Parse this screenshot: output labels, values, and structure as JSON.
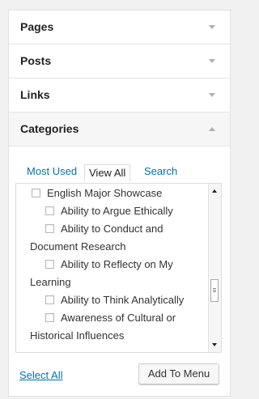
{
  "sections": [
    {
      "label": "Pages",
      "state": "collapsed"
    },
    {
      "label": "Posts",
      "state": "collapsed"
    },
    {
      "label": "Links",
      "state": "collapsed"
    },
    {
      "label": "Categories",
      "state": "expanded"
    }
  ],
  "tabs": [
    {
      "label": "Most Used",
      "active": false
    },
    {
      "label": "View All",
      "active": true
    },
    {
      "label": "Search",
      "active": false
    }
  ],
  "categories": [
    {
      "line1": "English Major Showcase",
      "level": 0,
      "checked": false
    },
    {
      "line1": "Ability to Argue Ethically",
      "level": 1,
      "checked": false
    },
    {
      "line1": "Ability to Conduct and",
      "line2": "Document Research",
      "level": 1,
      "checked": false
    },
    {
      "line1": "Ability to Reflecty on My",
      "line2": "Learning",
      "level": 1,
      "checked": false
    },
    {
      "line1": "Ability to Think Analytically",
      "level": 1,
      "checked": false
    },
    {
      "line1": "Awareness of Cultural or",
      "line2": "Historical Influences",
      "level": 1,
      "checked": false
    }
  ],
  "footer": {
    "select_all": "Select All",
    "add_button": "Add To Menu"
  },
  "colors": {
    "link": "#0073aa",
    "text": "#333333",
    "background": "#f1f1f1"
  }
}
